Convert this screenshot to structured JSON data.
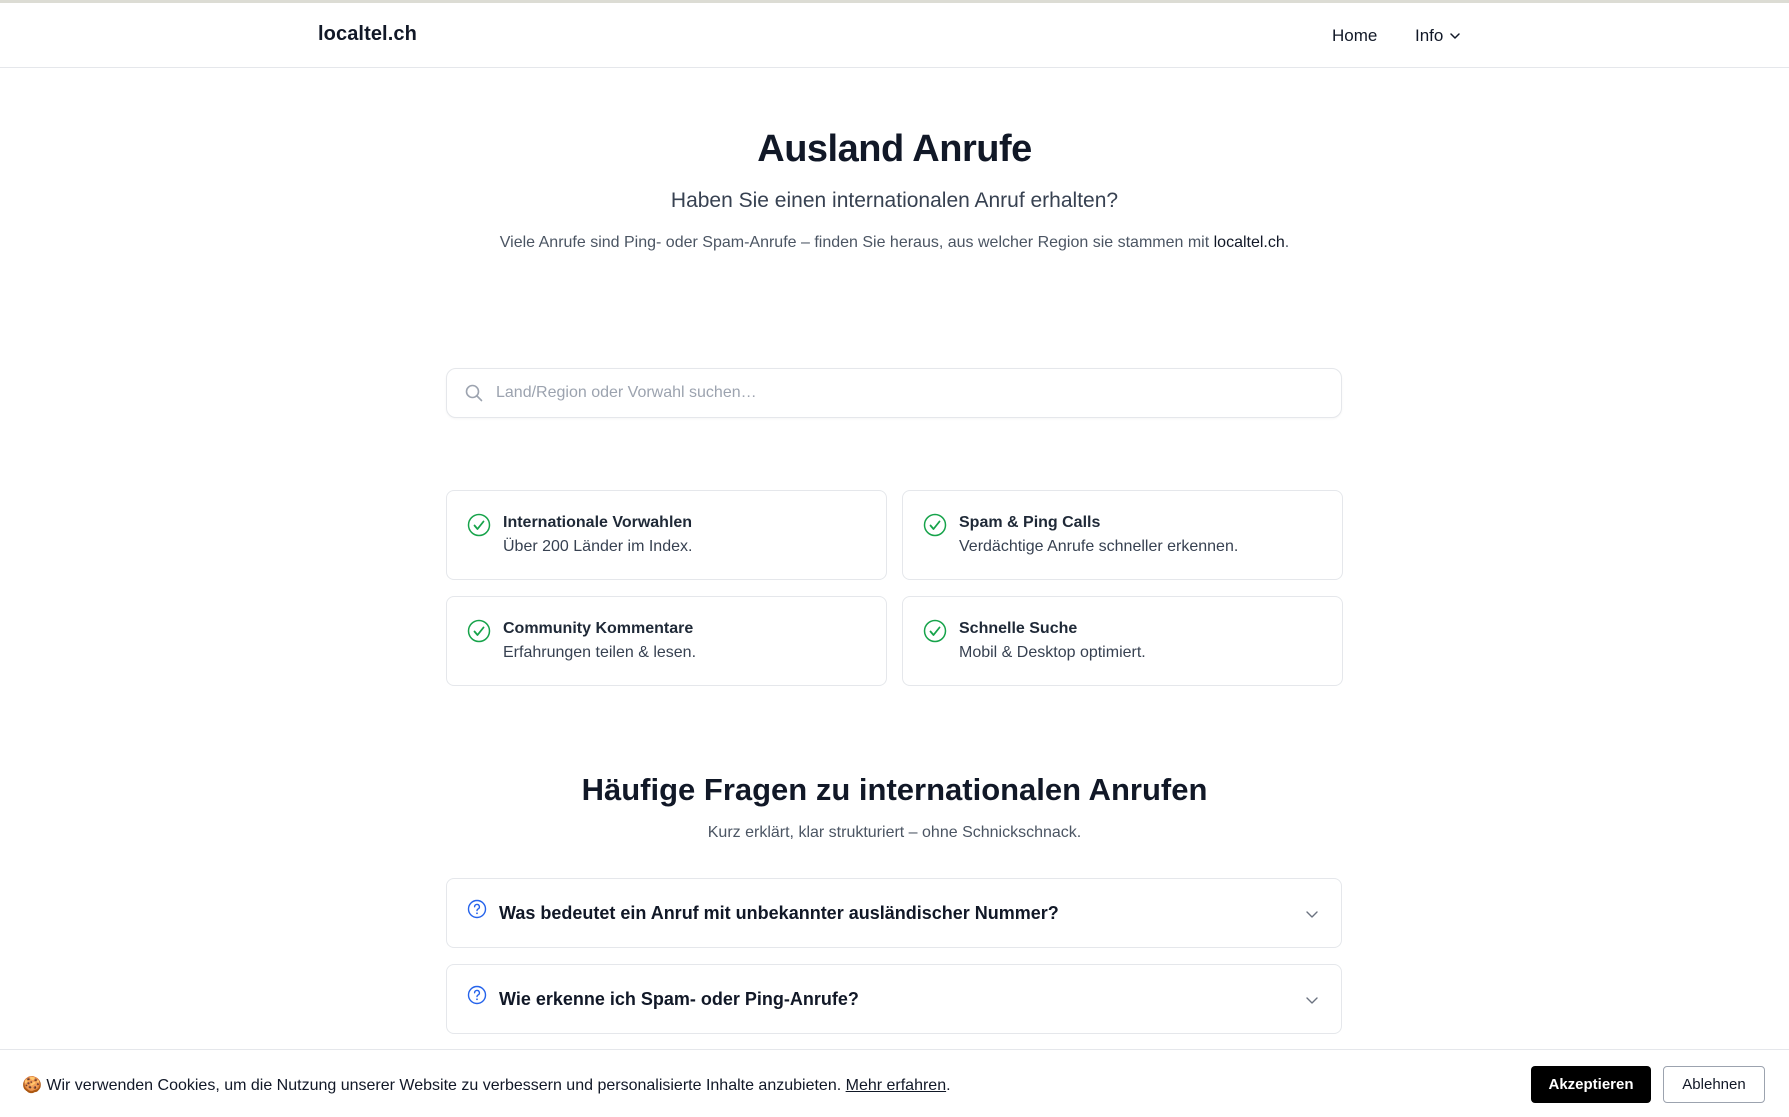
{
  "header": {
    "brand": "localtel.ch",
    "nav": {
      "home": "Home",
      "info": "Info"
    }
  },
  "hero": {
    "title": "Ausland Anrufe",
    "subtitle": "Haben Sie einen internationalen Anruf erhalten?",
    "description_prefix": "Viele Anrufe sind Ping- oder Spam-Anrufe – finden Sie heraus, aus welcher Region sie stammen mit ",
    "description_link": "localtel.ch",
    "description_suffix": "."
  },
  "search": {
    "placeholder": "Land/Region oder Vorwahl suchen…",
    "value": "",
    "icon": "search-icon"
  },
  "features": [
    {
      "title": "Internationale Vorwahlen",
      "description": "Über 200 Länder im Index.",
      "icon": "check-circle-icon"
    },
    {
      "title": "Spam & Ping Calls",
      "description": "Verdächtige Anrufe schneller erkennen.",
      "icon": "check-circle-icon"
    },
    {
      "title": "Community Kommentare",
      "description": "Erfahrungen teilen & lesen.",
      "icon": "check-circle-icon"
    },
    {
      "title": "Schnelle Suche",
      "description": "Mobil & Desktop optimiert.",
      "icon": "check-circle-icon"
    }
  ],
  "faq": {
    "title": "Häufige Fragen zu internationalen Anrufen",
    "subtitle": "Kurz erklärt, klar strukturiert – ohne Schnickschnack.",
    "items": [
      {
        "question": "Was bedeutet ein Anruf mit unbekannter ausländischer Nummer?"
      },
      {
        "question": "Wie erkenne ich Spam- oder Ping-Anrufe?"
      }
    ]
  },
  "cookie_banner": {
    "emoji": "🍪",
    "text": " Wir verwenden Cookies, um die Nutzung unserer Website zu verbessern und personalisierte Inhalte anzubieten. ",
    "link": "Mehr erfahren",
    "suffix": ".",
    "accept_label": "Akzeptieren",
    "decline_label": "Ablehnen"
  },
  "colors": {
    "check_green": "#16a34a",
    "question_blue": "#2563eb",
    "accept_bg": "#000000"
  }
}
